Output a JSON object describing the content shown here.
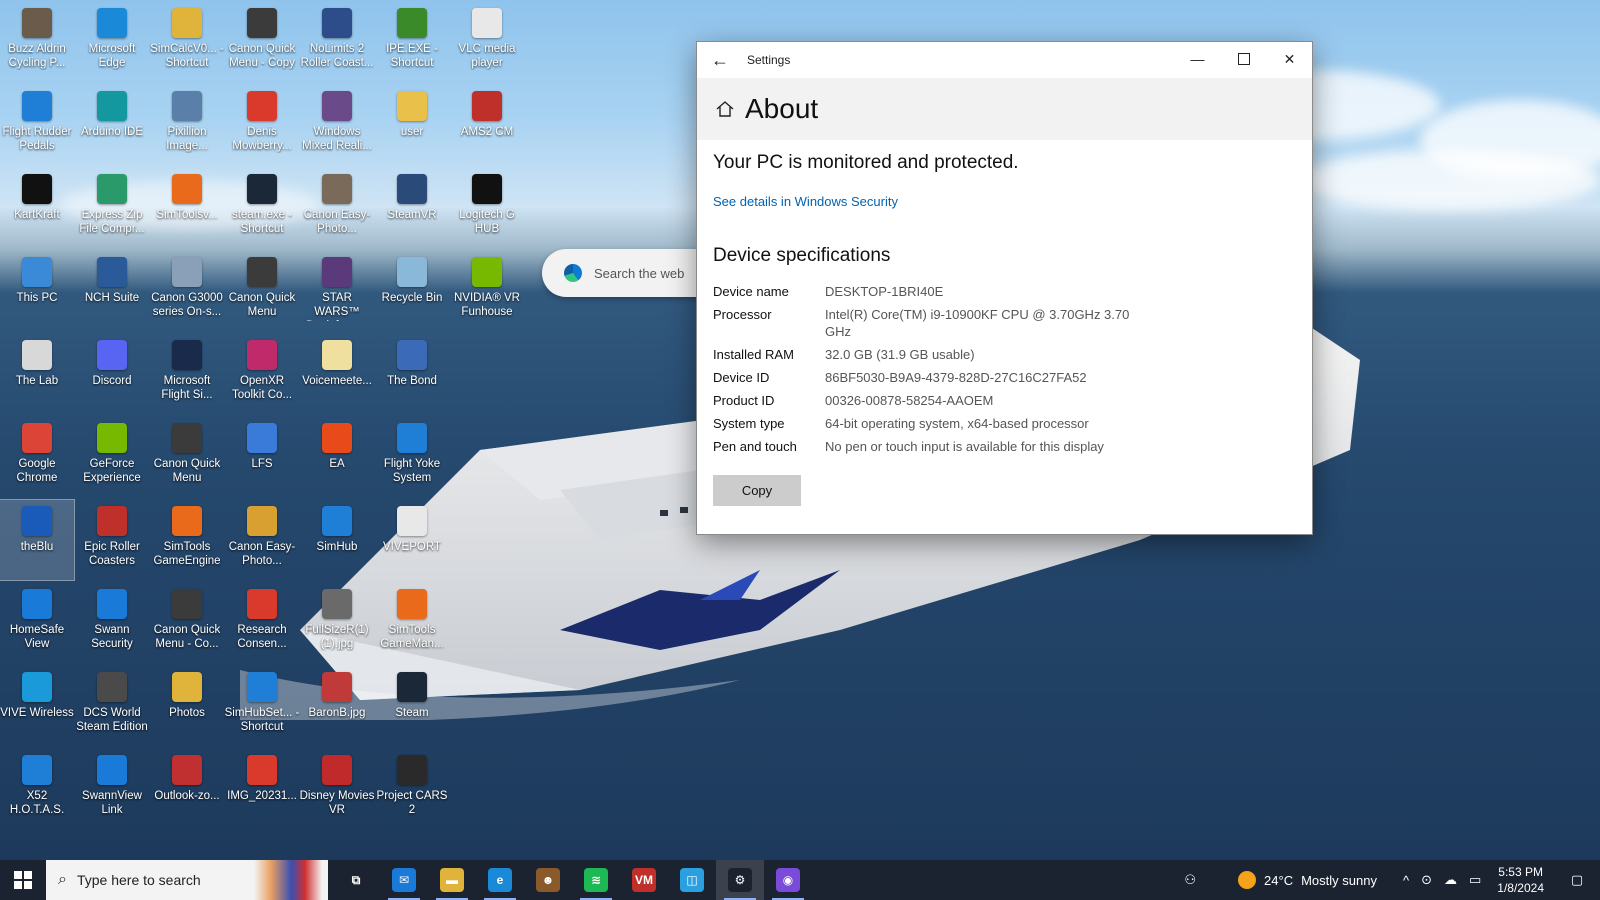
{
  "desktop": {
    "search_placeholder": "Search the web",
    "icons": [
      {
        "label": "Buzz Aldrin Cycling P...",
        "icon": "cyclist-photo-icon",
        "color": "#6b5b4b"
      },
      {
        "label": "Microsoft Edge",
        "icon": "edge-icon",
        "color": "#1a8ad8"
      },
      {
        "label": "SimCalcV0... - Shortcut",
        "icon": "folder-icon",
        "color": "#e0b43a"
      },
      {
        "label": "Canon Quick Menu - Copy",
        "icon": "canon-quick-menu-icon",
        "color": "#3b3b3b"
      },
      {
        "label": "NoLimits 2 Roller Coast...",
        "icon": "rollercoaster-icon",
        "color": "#2c4d8a"
      },
      {
        "label": "IPE.EXE - Shortcut",
        "icon": "sun-burst-icon",
        "color": "#3a8a2a"
      },
      {
        "label": "VLC media player",
        "icon": "file-icon",
        "color": "#e8e8e8"
      },
      {
        "label": "Flight Rudder Pedals",
        "icon": "flight-icon",
        "color": "#1f7fd6"
      },
      {
        "label": "Arduino IDE",
        "icon": "arduino-icon",
        "color": "#12989e"
      },
      {
        "label": "Pixillion Image...",
        "icon": "image-converter-icon",
        "color": "#5a7fa8"
      },
      {
        "label": "Denis Mowberry...",
        "icon": "pdf-icon",
        "color": "#d93a2b"
      },
      {
        "label": "Windows Mixed Reali...",
        "icon": "mixed-reality-icon",
        "color": "#6b4a8a"
      },
      {
        "label": "user",
        "icon": "user-folder-icon",
        "color": "#e8c04a"
      },
      {
        "label": "AMS2 CM",
        "icon": "ams2-icon",
        "color": "#c0302a"
      },
      {
        "label": "KartKraft",
        "icon": "kartkraft-icon",
        "color": "#111111"
      },
      {
        "label": "Express Zip File Compr...",
        "icon": "zip-icon",
        "color": "#2a9a6a"
      },
      {
        "label": "SimToolsv...",
        "icon": "power-icon",
        "color": "#e86a1a"
      },
      {
        "label": "steam.exe - Shortcut",
        "icon": "steam-icon",
        "color": "#1b2838"
      },
      {
        "label": "Canon Easy-Photo...",
        "icon": "canon-photo-icon",
        "color": "#7a6a5a"
      },
      {
        "label": "SteamVR",
        "icon": "steamvr-icon",
        "color": "#2a4a7a"
      },
      {
        "label": "Logitech G HUB",
        "icon": "logitech-icon",
        "color": "#111111"
      },
      {
        "label": "This PC",
        "icon": "computer-icon",
        "color": "#3a8ad8"
      },
      {
        "label": "NCH Suite",
        "icon": "nch-suite-icon",
        "color": "#2a5a9a"
      },
      {
        "label": "Canon G3000 series On-s...",
        "icon": "canon-manual-icon",
        "color": "#8aa0b8"
      },
      {
        "label": "Canon Quick Menu",
        "icon": "canon-quick-menu-icon",
        "color": "#3b3b3b"
      },
      {
        "label": "STAR WARS™ Battlefront...",
        "icon": "star-wars-icon",
        "color": "#5a3a7a"
      },
      {
        "label": "Recycle Bin",
        "icon": "recycle-bin-icon",
        "color": "#8ab8d8"
      },
      {
        "label": "NVIDIA® VR Funhouse",
        "icon": "nvidia-icon",
        "color": "#76b900"
      },
      {
        "label": "The Lab",
        "icon": "the-lab-icon",
        "color": "#d8d8d8"
      },
      {
        "label": "Discord",
        "icon": "discord-icon",
        "color": "#5865f2"
      },
      {
        "label": "Microsoft Flight Si...",
        "icon": "flight-sim-icon",
        "color": "#1a2a4a"
      },
      {
        "label": "OpenXR Toolkit Co...",
        "icon": "openxr-icon",
        "color": "#c02a6a"
      },
      {
        "label": "Voicemeete...",
        "icon": "document-icon",
        "color": "#f0e0a0"
      },
      {
        "label": "The Bond",
        "icon": "shortcut-icon",
        "color": "#3a6ab8"
      },
      {
        "label": "Google Chrome",
        "icon": "chrome-icon",
        "color": "#db4437"
      },
      {
        "label": "GeForce Experience",
        "icon": "geforce-icon",
        "color": "#76b900"
      },
      {
        "label": "Canon Quick Menu",
        "icon": "canon-quick-menu-icon",
        "color": "#3b3b3b"
      },
      {
        "label": "LFS",
        "icon": "lfs-icon",
        "color": "#3a7ad8"
      },
      {
        "label": "EA",
        "icon": "ea-icon",
        "color": "#e84a1a"
      },
      {
        "label": "Flight Yoke System",
        "icon": "flight-icon",
        "color": "#1f7fd6"
      },
      {
        "label": "theBlu",
        "icon": "whale-icon",
        "color": "#1a5ab8"
      },
      {
        "label": "Epic Roller Coasters",
        "icon": "epic-roller-coasters-icon",
        "color": "#c0302a"
      },
      {
        "label": "SimTools GameEngine",
        "icon": "simtools-icon",
        "color": "#e86a1a"
      },
      {
        "label": "Canon Easy-Photo...",
        "icon": "canon-photo-icon",
        "color": "#d8a030"
      },
      {
        "label": "SimHub",
        "icon": "gamepad-icon",
        "color": "#1f7fd6"
      },
      {
        "label": "VIVEPORT",
        "icon": "viveport-icon",
        "color": "#e8e8e8"
      },
      {
        "label": "HomeSafe View",
        "icon": "homesafe-icon",
        "color": "#1a7ad8"
      },
      {
        "label": "Swann Security",
        "icon": "swann-icon",
        "color": "#1a7ad8"
      },
      {
        "label": "Canon Quick Menu - Co...",
        "icon": "canon-quick-menu-icon",
        "color": "#3b3b3b"
      },
      {
        "label": "Research Consen...",
        "icon": "pdf-icon",
        "color": "#d93a2b"
      },
      {
        "label": "FullSizeR(1) (1).jpg",
        "icon": "jpg-image-icon",
        "color": "#6a6a6a"
      },
      {
        "label": "SimTools GameMan...",
        "icon": "simtools-icon",
        "color": "#e86a1a"
      },
      {
        "label": "VIVE Wireless",
        "icon": "vive-wireless-icon",
        "color": "#1a9ad8"
      },
      {
        "label": "DCS World Steam Edition",
        "icon": "dcs-icon",
        "color": "#4a4a4a"
      },
      {
        "label": "Photos",
        "icon": "photos-folder-icon",
        "color": "#e0b43a"
      },
      {
        "label": "SimHubSet... - Shortcut",
        "icon": "gamepad-icon",
        "color": "#1f7fd6"
      },
      {
        "label": "BaronB.jpg",
        "icon": "jpg-image-icon",
        "color": "#c03a3a"
      },
      {
        "label": "Steam",
        "icon": "steam-icon",
        "color": "#1b2838"
      },
      {
        "label": "X52 H.O.T.A.S.",
        "icon": "flight-icon",
        "color": "#1f7fd6"
      },
      {
        "label": "SwannView Link",
        "icon": "swann-icon",
        "color": "#1a7ad8"
      },
      {
        "label": "Outlook-zo...",
        "icon": "outlook-icon",
        "color": "#c03030"
      },
      {
        "label": "IMG_20231...",
        "icon": "pdf-icon",
        "color": "#d93a2b"
      },
      {
        "label": "Disney Movies VR",
        "icon": "disney-vr-icon",
        "color": "#c02a2a"
      },
      {
        "label": "Project CARS 2",
        "icon": "project-cars-icon",
        "color": "#2a2a2a"
      }
    ]
  },
  "settings": {
    "window_title": "Settings",
    "page_title": "About",
    "protected_text": "Your PC is monitored and protected.",
    "security_link": "See details in Windows Security",
    "specs_heading": "Device specifications",
    "specs": [
      {
        "key": "Device name",
        "value": "DESKTOP-1BRI40E"
      },
      {
        "key": "Processor",
        "value": "Intel(R) Core(TM) i9-10900KF CPU @ 3.70GHz   3.70 GHz"
      },
      {
        "key": "Installed RAM",
        "value": "32.0 GB (31.9 GB usable)"
      },
      {
        "key": "Device ID",
        "value": "86BF5030-B9A9-4379-828D-27C16C27FA52"
      },
      {
        "key": "Product ID",
        "value": "00326-00878-58254-AAOEM"
      },
      {
        "key": "System type",
        "value": "64-bit operating system, x64-based processor"
      },
      {
        "key": "Pen and touch",
        "value": "No pen or touch input is available for this display"
      }
    ],
    "copy_label": "Copy"
  },
  "taskbar": {
    "search_placeholder": "Type here to search",
    "apps": [
      {
        "name": "task-view",
        "icon": "task-view-icon",
        "glyph": "⧉",
        "color": "#1b2230"
      },
      {
        "name": "mail",
        "icon": "mail-icon",
        "glyph": "✉",
        "color": "#1a7ad8"
      },
      {
        "name": "file-explorer",
        "icon": "folder-icon",
        "glyph": "▬",
        "color": "#e0b43a"
      },
      {
        "name": "edge",
        "icon": "edge-icon",
        "glyph": "e",
        "color": "#1a8ad8"
      },
      {
        "name": "game-app",
        "icon": "character-icon",
        "glyph": "☻",
        "color": "#8a5a2a"
      },
      {
        "name": "spotify",
        "icon": "spotify-icon",
        "glyph": "≋",
        "color": "#1db954"
      },
      {
        "name": "voicemeeter",
        "icon": "voicemeeter-icon",
        "glyph": "VM",
        "color": "#c0302a"
      },
      {
        "name": "vr-app",
        "icon": "vr-headset-icon",
        "glyph": "◫",
        "color": "#2aa0e0"
      },
      {
        "name": "settings",
        "icon": "gear-icon",
        "glyph": "⚙",
        "color": "#1b2230"
      },
      {
        "name": "chat-app",
        "icon": "chat-app-icon",
        "glyph": "◉",
        "color": "#7a4ad8"
      }
    ],
    "weather_temp": "24°C",
    "weather_desc": "Mostly sunny",
    "time": "5:53 PM",
    "date": "1/8/2024"
  }
}
